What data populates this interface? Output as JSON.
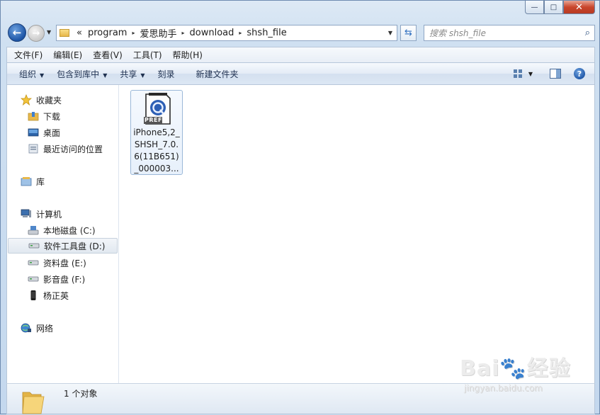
{
  "window": {
    "min_glyph": "—",
    "max_glyph": "□",
    "close_glyph": "✕"
  },
  "address": {
    "prefix": "«",
    "crumbs": [
      "program",
      "爱思助手",
      "download",
      "shsh_file"
    ],
    "crumb_separator": "▸"
  },
  "search": {
    "placeholder": "搜索 shsh_file"
  },
  "menu": [
    "文件(F)",
    "编辑(E)",
    "查看(V)",
    "工具(T)",
    "帮助(H)"
  ],
  "commands": [
    {
      "label": "组织",
      "has_arrow": true
    },
    {
      "label": "包含到库中",
      "has_arrow": true
    },
    {
      "label": "共享",
      "has_arrow": true
    },
    {
      "label": "刻录",
      "has_arrow": false
    },
    {
      "label": "新建文件夹",
      "has_arrow": false
    }
  ],
  "nav": {
    "favorites": {
      "label": "收藏夹",
      "items": [
        "下载",
        "桌面",
        "最近访问的位置"
      ]
    },
    "libraries": {
      "label": "库"
    },
    "computer": {
      "label": "计算机",
      "items": [
        "本地磁盘 (C:)",
        "软件工具盘 (D:)",
        "资料盘 (E:)",
        "影音盘 (F:)",
        "杨正英"
      ],
      "selected_index": 1
    },
    "network": {
      "label": "网络"
    }
  },
  "file": {
    "name": "iPhone5,2_SHSH_7.0.6(11B651)_000003...",
    "icon_badge": "PREF"
  },
  "status": {
    "count_text": "1 个对象"
  },
  "watermark": {
    "logo": "Bai🐾经验",
    "url": "jingyan.baidu.com"
  },
  "colors": {
    "accent": "#1d55a6",
    "selection": "#e1e8f0",
    "folder": "#e8b84a"
  }
}
